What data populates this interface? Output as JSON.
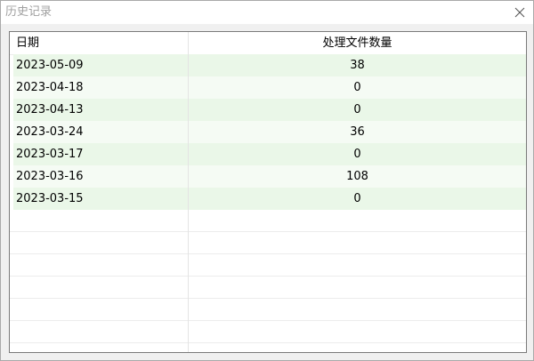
{
  "window": {
    "title": "历史记录"
  },
  "table": {
    "columns": [
      "日期",
      "处理文件数量"
    ],
    "rows": [
      {
        "date": "2023-05-09",
        "count": "38"
      },
      {
        "date": "2023-04-18",
        "count": "0"
      },
      {
        "date": "2023-04-13",
        "count": "0"
      },
      {
        "date": "2023-03-24",
        "count": "36"
      },
      {
        "date": "2023-03-17",
        "count": "0"
      },
      {
        "date": "2023-03-16",
        "count": "108"
      },
      {
        "date": "2023-03-15",
        "count": "0"
      }
    ]
  },
  "colors": {
    "row_even": "#eaf7e8",
    "row_odd": "#f5fbf4",
    "title_text": "#a0a0a0"
  },
  "icons": {
    "close": "close-icon"
  }
}
